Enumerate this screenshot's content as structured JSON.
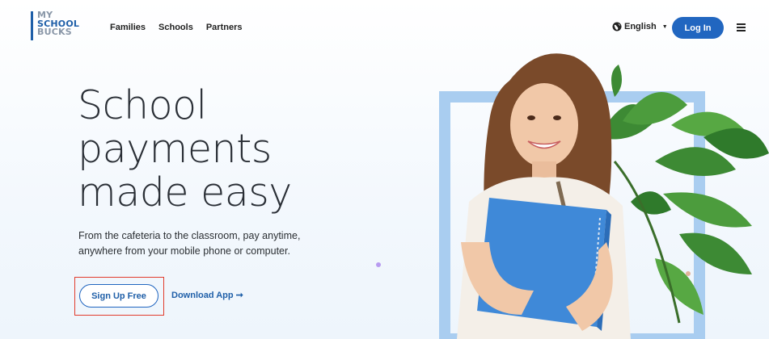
{
  "header": {
    "logo": {
      "line1": "MY",
      "line2": "SCHOOL",
      "line3": "BUCKS"
    },
    "nav": [
      "Families",
      "Schools",
      "Partners"
    ],
    "language": "English",
    "login_label": "Log In"
  },
  "hero": {
    "headline": [
      "School",
      "payments",
      "made easy"
    ],
    "subtext": "From the cafeteria to the classroom, pay anytime, anywhere from your mobile phone or computer.",
    "signup_label": "Sign Up Free",
    "download_label": "Download App"
  },
  "icons": [
    "globe-icon",
    "caret-down-icon",
    "hamburger-menu-icon",
    "arrow-right-icon"
  ],
  "colors": {
    "primary": "#2166c0",
    "highlight_box": "#e13b2c",
    "frame": "#a9cdf0",
    "notebook": "#3f89d8"
  }
}
